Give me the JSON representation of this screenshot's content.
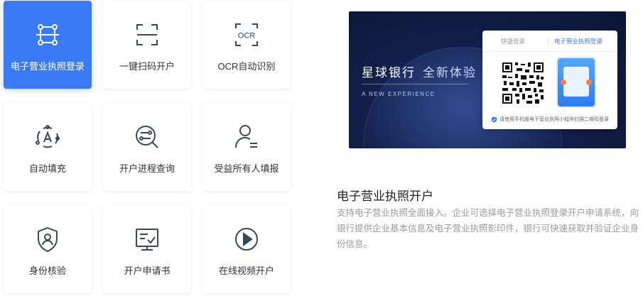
{
  "features": [
    {
      "label": "电子营业执照登录",
      "icon": "license-scan-icon",
      "active": true
    },
    {
      "label": "一键扫码开户",
      "icon": "scan-frame-icon",
      "active": false
    },
    {
      "label": "OCR自动识别",
      "icon": "ocr-icon",
      "active": false
    },
    {
      "label": "自动填充",
      "icon": "auto-fill-icon",
      "active": false
    },
    {
      "label": "开户进程查询",
      "icon": "progress-search-icon",
      "active": false
    },
    {
      "label": "受益所有人填报",
      "icon": "user-form-icon",
      "active": false
    },
    {
      "label": "身份核验",
      "icon": "shield-user-icon",
      "active": false
    },
    {
      "label": "开户申请书",
      "icon": "document-check-icon",
      "active": false
    },
    {
      "label": "在线视频开户",
      "icon": "play-icon",
      "active": false
    }
  ],
  "ocr_icon_text": "OCR",
  "banner": {
    "brand": "星球银行",
    "slogan": "全新体验",
    "english": "A NEW EXPERIENCE",
    "login": {
      "tab_quick": "快捷登录",
      "tab_license": "电子营业执照登录",
      "tip": "请使用手机版电子营业执照小程序扫描二维码登录"
    }
  },
  "info": {
    "title": "电子营业执照开户",
    "description": "支持电子营业执照全面接入。企业可选择电子营业执照登录开户申请系统，向银行提供企业基本信息及电子营业执照影印件，银行可快速获取并验证企业身份信息。"
  },
  "colors": {
    "accent": "#3a7bf5",
    "icon_stroke": "#34495e"
  }
}
